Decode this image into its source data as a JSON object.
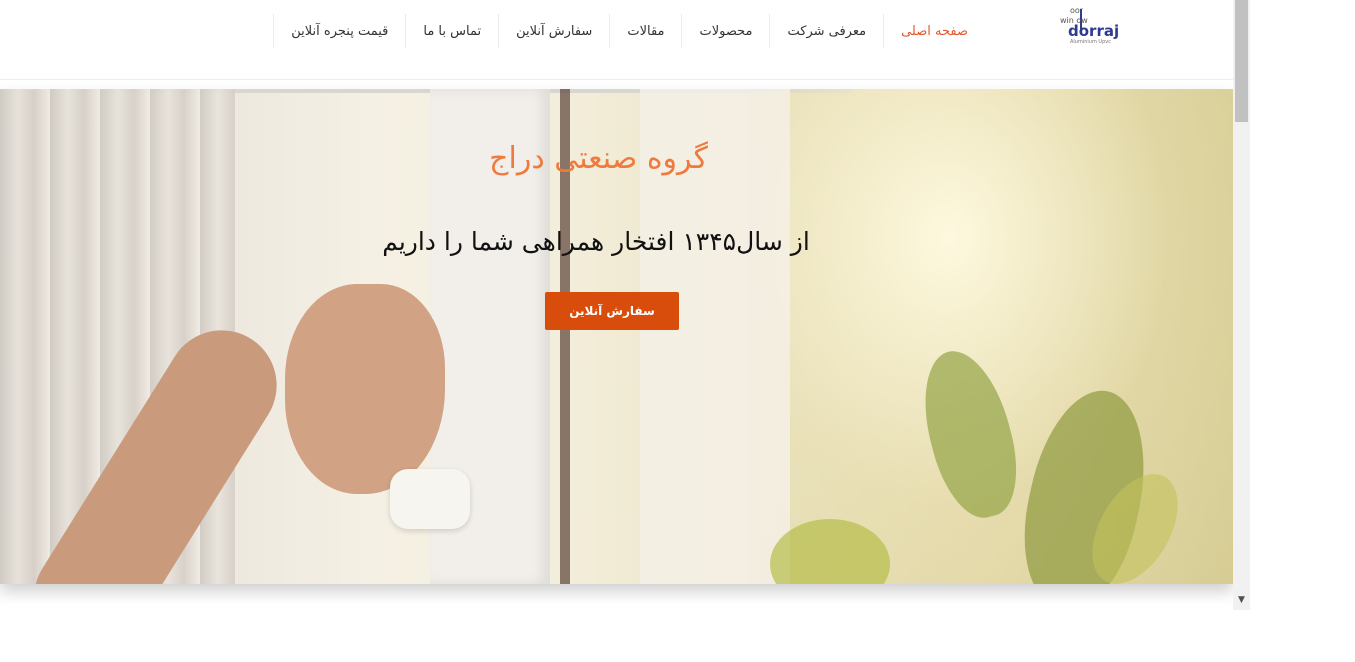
{
  "header": {
    "logo": {
      "line1": "oor",
      "line2": "win  ow",
      "brand": "dorraj",
      "tagline": "Aluminium Upvc"
    },
    "nav": [
      {
        "label": "صفحه اصلی",
        "active": true
      },
      {
        "label": "معرفی شرکت",
        "active": false
      },
      {
        "label": "محصولات",
        "active": false
      },
      {
        "label": "مقالات",
        "active": false
      },
      {
        "label": "سفارش آنلاین",
        "active": false
      },
      {
        "label": "تماس با ما",
        "active": false
      },
      {
        "label": "قیمت پنجره آنلاین",
        "active": false
      }
    ]
  },
  "hero": {
    "title": "گروه صنعتی دراج",
    "subtitle": "از سال۱۳۴۵ افتخار همراهی شما را داریم",
    "cta_label": "سفارش آنلاین"
  },
  "scrollbar": {
    "down_arrow": "▼"
  },
  "colors": {
    "accent": "#e5582a",
    "button": "#d84c0c",
    "title": "#f07a3e",
    "brand": "#2c3a8f"
  }
}
